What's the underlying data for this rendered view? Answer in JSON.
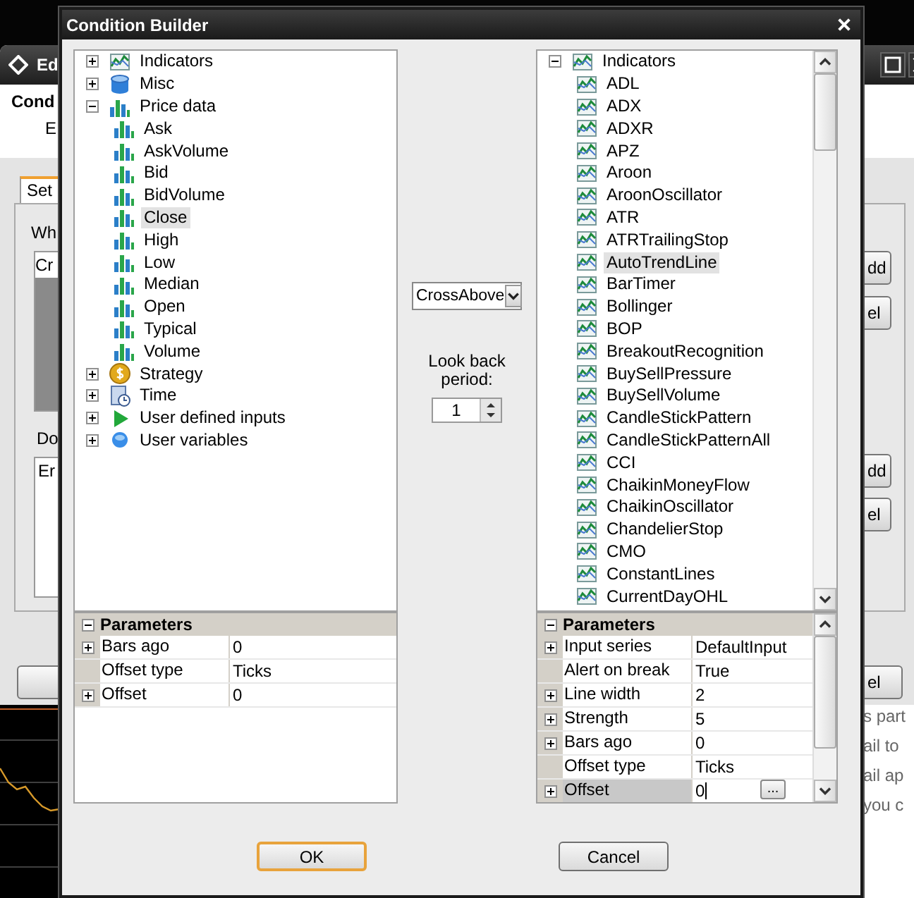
{
  "background_window": {
    "title": "Ed",
    "heading": "Cond",
    "subheading": "E",
    "tab": "Set",
    "label_1": "Wh",
    "list_1_item": "Cr",
    "label_2": "Do",
    "list_2_item": "Er",
    "side_buttons": [
      "dd",
      "el",
      "dd",
      "el"
    ],
    "bottom_button": "el"
  },
  "web_text": [
    "s part",
    "ail to",
    "ail ap",
    "you c"
  ],
  "dialog": {
    "title": "Condition Builder",
    "left_tree": [
      {
        "label": "Indicators",
        "kind": "indicator",
        "expanded": false,
        "selected": false
      },
      {
        "label": "Misc",
        "kind": "misc",
        "expanded": false,
        "selected": false
      },
      {
        "label": "Price data",
        "kind": "price",
        "expanded": true,
        "selected": false,
        "children": [
          {
            "label": "Ask",
            "kind": "price",
            "selected": false
          },
          {
            "label": "AskVolume",
            "kind": "price",
            "selected": false
          },
          {
            "label": "Bid",
            "kind": "price",
            "selected": false
          },
          {
            "label": "BidVolume",
            "kind": "price",
            "selected": false
          },
          {
            "label": "Close",
            "kind": "price",
            "selected": true
          },
          {
            "label": "High",
            "kind": "price",
            "selected": false
          },
          {
            "label": "Low",
            "kind": "price",
            "selected": false
          },
          {
            "label": "Median",
            "kind": "price",
            "selected": false
          },
          {
            "label": "Open",
            "kind": "price",
            "selected": false
          },
          {
            "label": "Typical",
            "kind": "price",
            "selected": false
          },
          {
            "label": "Volume",
            "kind": "price",
            "selected": false
          }
        ]
      },
      {
        "label": "Strategy",
        "kind": "strategy",
        "expanded": false,
        "selected": false
      },
      {
        "label": "Time",
        "kind": "time",
        "expanded": false,
        "selected": false
      },
      {
        "label": "User defined inputs",
        "kind": "input",
        "expanded": false,
        "selected": false
      },
      {
        "label": "User variables",
        "kind": "variable",
        "expanded": false,
        "selected": false
      }
    ],
    "left_parameters": {
      "header": "Parameters",
      "expanded": true,
      "rows": [
        {
          "name": "Bars ago",
          "value": "0",
          "expandable": true,
          "selected": false
        },
        {
          "name": "Offset type",
          "value": "Ticks",
          "expandable": false,
          "selected": false
        },
        {
          "name": "Offset",
          "value": "0",
          "expandable": true,
          "selected": false
        }
      ]
    },
    "operator": "CrossAbove",
    "lookback_label": "Look back period:",
    "lookback_value": "1",
    "right_tree": [
      {
        "label": "Indicators",
        "kind": "indicator",
        "expanded": true,
        "selected": false,
        "children": [
          {
            "label": "ADL",
            "kind": "indicator",
            "selected": false
          },
          {
            "label": "ADX",
            "kind": "indicator",
            "selected": false
          },
          {
            "label": "ADXR",
            "kind": "indicator",
            "selected": false
          },
          {
            "label": "APZ",
            "kind": "indicator",
            "selected": false
          },
          {
            "label": "Aroon",
            "kind": "indicator",
            "selected": false
          },
          {
            "label": "AroonOscillator",
            "kind": "indicator",
            "selected": false
          },
          {
            "label": "ATR",
            "kind": "indicator",
            "selected": false
          },
          {
            "label": "ATRTrailingStop",
            "kind": "indicator",
            "selected": false
          },
          {
            "label": "AutoTrendLine",
            "kind": "indicator",
            "selected": true
          },
          {
            "label": "BarTimer",
            "kind": "indicator",
            "selected": false
          },
          {
            "label": "Bollinger",
            "kind": "indicator",
            "selected": false
          },
          {
            "label": "BOP",
            "kind": "indicator",
            "selected": false
          },
          {
            "label": "BreakoutRecognition",
            "kind": "indicator",
            "selected": false
          },
          {
            "label": "BuySellPressure",
            "kind": "indicator",
            "selected": false
          },
          {
            "label": "BuySellVolume",
            "kind": "indicator",
            "selected": false
          },
          {
            "label": "CandleStickPattern",
            "kind": "indicator",
            "selected": false
          },
          {
            "label": "CandleStickPatternAll",
            "kind": "indicator",
            "selected": false
          },
          {
            "label": "CCI",
            "kind": "indicator",
            "selected": false
          },
          {
            "label": "ChaikinMoneyFlow",
            "kind": "indicator",
            "selected": false
          },
          {
            "label": "ChaikinOscillator",
            "kind": "indicator",
            "selected": false
          },
          {
            "label": "ChandelierStop",
            "kind": "indicator",
            "selected": false
          },
          {
            "label": "CMO",
            "kind": "indicator",
            "selected": false
          },
          {
            "label": "ConstantLines",
            "kind": "indicator",
            "selected": false
          },
          {
            "label": "CurrentDayOHL",
            "kind": "indicator",
            "selected": false
          }
        ]
      }
    ],
    "right_parameters": {
      "header": "Parameters",
      "expanded": true,
      "rows": [
        {
          "name": "Input series",
          "value": "DefaultInput",
          "expandable": true,
          "selected": false
        },
        {
          "name": "Alert on break",
          "value": "True",
          "expandable": false,
          "selected": false
        },
        {
          "name": "Line width",
          "value": "2",
          "expandable": true,
          "selected": false
        },
        {
          "name": "Strength",
          "value": "5",
          "expandable": true,
          "selected": false
        },
        {
          "name": "Bars ago",
          "value": "0",
          "expandable": true,
          "selected": false
        },
        {
          "name": "Offset type",
          "value": "Ticks",
          "expandable": false,
          "selected": false
        },
        {
          "name": "Offset",
          "value": "0",
          "expandable": true,
          "selected": true,
          "button": "..."
        }
      ]
    },
    "buttons": [
      {
        "label": "OK",
        "default": true
      },
      {
        "label": "Cancel",
        "default": false
      }
    ]
  }
}
